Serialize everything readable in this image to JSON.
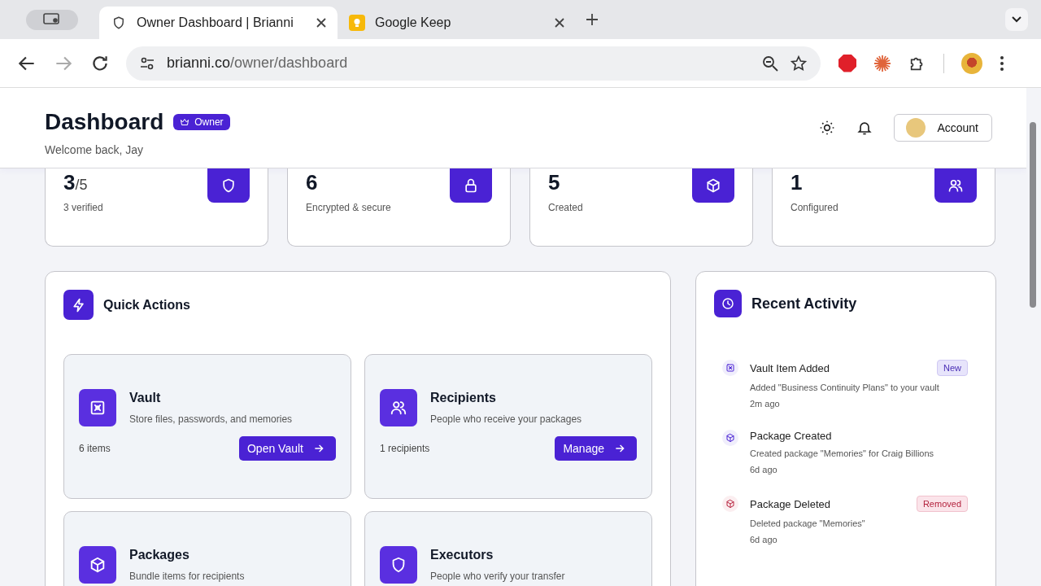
{
  "browser": {
    "tabs": [
      {
        "title": "Owner Dashboard | Brianni",
        "kind": "site",
        "selected": true
      },
      {
        "title": "Google Keep",
        "kind": "keep",
        "selected": false
      }
    ],
    "forward": {
      "disabled": true
    },
    "url": {
      "host": "brianni.co",
      "path": "/owner/dashboard"
    }
  },
  "header": {
    "title": "Dashboard",
    "role_badge": "Owner",
    "subtitle": "Welcome back, Jay",
    "account_button": "Account"
  },
  "stats": [
    {
      "value": "3",
      "total": "/5",
      "label": "3 verified",
      "kind": "executors"
    },
    {
      "value": "6",
      "label": "Encrypted & secure",
      "kind": "vault"
    },
    {
      "value": "5",
      "label": "Created",
      "kind": "packages"
    },
    {
      "value": "1",
      "label": "Configured",
      "kind": "recipients"
    }
  ],
  "quick_actions": {
    "title": "Quick Actions",
    "items": [
      {
        "title": "Vault",
        "description": "Store files, passwords, and memories",
        "count": "6 items",
        "button": "Open Vault",
        "kind": "vault"
      },
      {
        "title": "Recipients",
        "description": "People who receive your packages",
        "count": "1 recipients",
        "button": "Manage",
        "kind": "recipients"
      },
      {
        "title": "Packages",
        "description": "Bundle items for recipients",
        "kind": "packages"
      },
      {
        "title": "Executors",
        "description": "People who verify your transfer",
        "kind": "executors"
      }
    ]
  },
  "recent_activity": {
    "title": "Recent Activity",
    "items": [
      {
        "title": "Vault Item Added",
        "description": "Added \"Business Continuity Plans\" to your vault",
        "time": "2m ago",
        "kind": "vault_added",
        "badge": {
          "label": "New",
          "kind": "new"
        }
      },
      {
        "title": "Package Created",
        "description": "Created package \"Memories\" for Craig Billions",
        "time": "6d ago",
        "kind": "package_created"
      },
      {
        "title": "Package Deleted",
        "description": "Deleted package \"Memories\"",
        "time": "6d ago",
        "kind": "package_deleted",
        "badge": {
          "label": "Removed",
          "kind": "removed"
        }
      }
    ]
  }
}
